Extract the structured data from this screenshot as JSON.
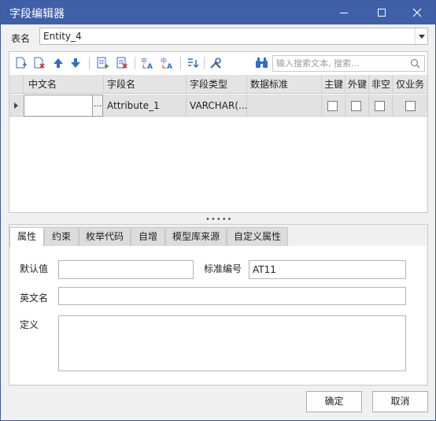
{
  "window": {
    "title": "字段编辑器"
  },
  "table_name": {
    "label": "表名",
    "value": "Entity_4"
  },
  "toolbar": {
    "icons": [
      "add-field-icon",
      "delete-field-icon",
      "move-up-icon",
      "move-down-icon",
      "insert-row-icon",
      "clear-icon",
      "rename-a-icon",
      "rename-b-icon",
      "import-icon",
      "tools-icon",
      "find-icon"
    ],
    "search_placeholder": "输入搜索文本, 搜索..."
  },
  "grid": {
    "columns": [
      "中文名",
      "字段名",
      "字段类型",
      "数据标准",
      "主键",
      "外键",
      "非空",
      "仅业务"
    ],
    "rows": [
      {
        "chinese_name": "",
        "ellipsis": "...",
        "field_name": "Attribute_1",
        "field_type": "VARCHAR(...",
        "data_standard": "",
        "primary_key": false,
        "foreign_key": false,
        "not_null": false,
        "business_only": false
      }
    ]
  },
  "splitter": "•••••",
  "tabs": [
    "属性",
    "约束",
    "枚举代码",
    "自增",
    "模型库来源",
    "自定义属性"
  ],
  "active_tab": "属性",
  "properties": {
    "default_label": "默认值",
    "default_value": "",
    "standard_no_label": "标准编号",
    "standard_no_value": "AT11",
    "english_name_label": "英文名",
    "english_name_value": "",
    "definition_label": "定义",
    "definition_value": ""
  },
  "buttons": {
    "ok": "确定",
    "cancel": "取消"
  },
  "colors": {
    "titlebar": "#3f5fa8",
    "icon_blue": "#2e6fc9",
    "icon_red": "#d9342b"
  }
}
